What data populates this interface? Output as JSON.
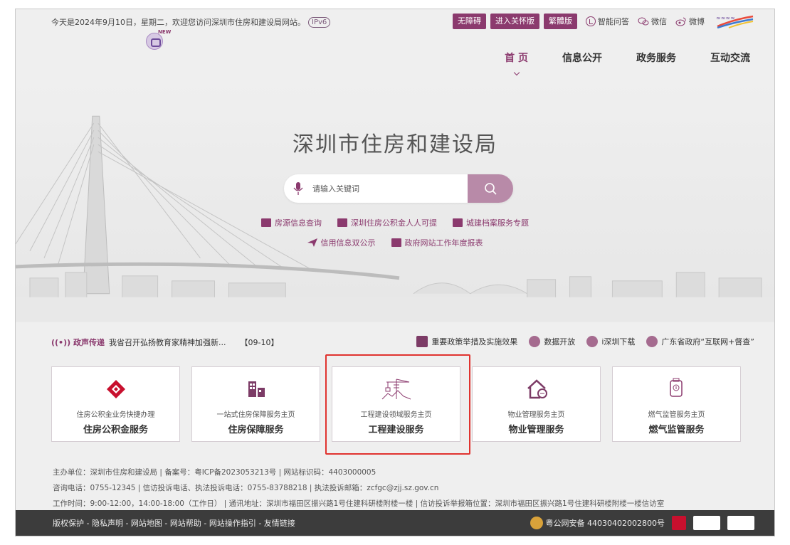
{
  "topbar": {
    "welcome": "今天是2024年9月10日，星期二，欢迎您访问深圳市住房和建设局网站。",
    "ipv6": "IPv6",
    "buttons": [
      "无障碍",
      "进入关怀版",
      "繁體版"
    ],
    "links": {
      "qa": "智能问答",
      "wechat": "微信",
      "weibo": "微博"
    }
  },
  "assistant": {
    "new_tag": "NEW"
  },
  "nav": {
    "items": [
      "首 页",
      "信息公开",
      "政务服务",
      "互动交流"
    ]
  },
  "hero": {
    "title": "深圳市住房和建设局",
    "search_placeholder": "请输入关键词",
    "quick_links_row1": [
      "房源信息查询",
      "深圳住房公积金人人可提",
      "城建档案服务专题"
    ],
    "quick_links_row2": [
      "信用信息双公示",
      "政府网站工作年度报表"
    ]
  },
  "newsbar": {
    "tag": "政声传递",
    "headline": "我省召开弘扬教育家精神加强新...",
    "date": "【09-10】",
    "links": [
      "重要政策举措及实施效果",
      "数据开放",
      "i深圳下载",
      "广东省政府“互联网+督查”"
    ]
  },
  "cards": [
    {
      "sub": "住房公积金业务快捷办理",
      "main": "住房公积金服务",
      "icon": "diamond-icon"
    },
    {
      "sub": "一站式住房保障服务主页",
      "main": "住房保障服务",
      "icon": "buildings-icon"
    },
    {
      "sub": "工程建设领域服务主页",
      "main": "工程建设服务",
      "icon": "crane-icon"
    },
    {
      "sub": "物业管理服务主页",
      "main": "物业管理服务",
      "icon": "house-icon"
    },
    {
      "sub": "燃气监管服务主页",
      "main": "燃气监管服务",
      "icon": "gas-icon"
    }
  ],
  "footer": {
    "line1": "主办单位：深圳市住房和建设局  |  备案号：粤ICP备2023053213号  |  网站标识码：4403000005",
    "line2": "咨询电话：0755-12345  |  信访投诉电话、执法投诉电话：0755-83788218  |  执法投诉邮箱：zcfgc@zjj.sz.gov.cn",
    "line3": "工作时间：9:00-12:00，14:00-18:00（工作日）  |  通讯地址：深圳市福田区振兴路1号住建科研楼附楼一楼  |  信访投诉举报箱位置：深圳市福田区振兴路1号住建科研楼附楼一楼信访室"
  },
  "bottombar": {
    "links": "版权保护 - 隐私声明 - 网站地图 - 网站帮助 - 网站操作指引 - 友情链接",
    "police": "粤公网安备 44030402002800号"
  },
  "colors": {
    "accent": "#8b3a6e",
    "highlight": "#e0332f",
    "bottombar": "#3c3c3c"
  }
}
